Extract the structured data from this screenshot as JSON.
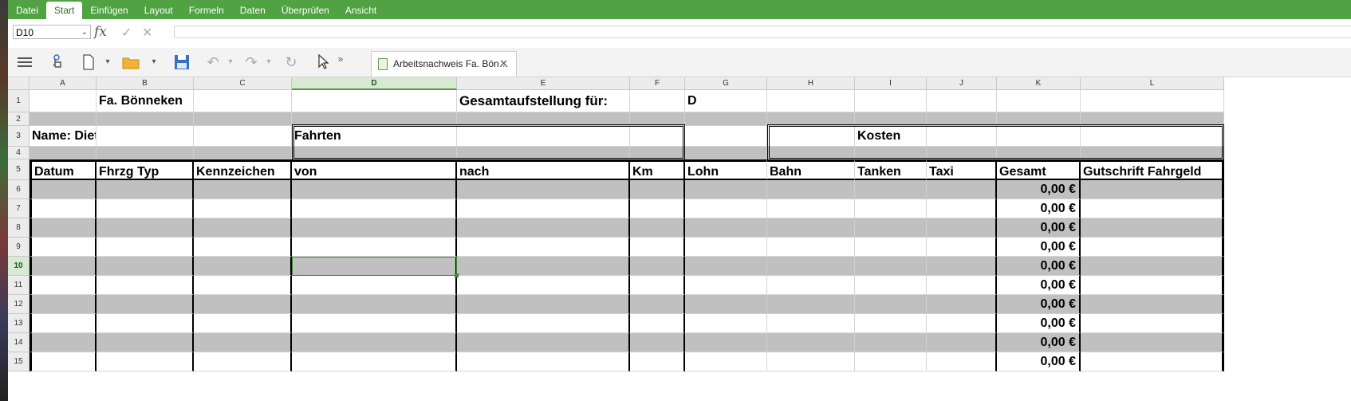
{
  "menu": {
    "items": [
      "Datei",
      "Start",
      "Einfügen",
      "Layout",
      "Formeln",
      "Daten",
      "Überprüfen",
      "Ansicht"
    ],
    "active": "Start"
  },
  "formula_bar": {
    "cell_ref": "D10",
    "fx_label": "fx",
    "accept_icon": "✓",
    "cancel_icon": "✕",
    "value": ""
  },
  "toolbar": {
    "document_tab_title": "Arbeitsnachweis Fa. Bön…",
    "tab_close": "✕",
    "overflow": "»"
  },
  "sheet": {
    "columns": [
      "A",
      "B",
      "C",
      "D",
      "E",
      "F",
      "G",
      "H",
      "I",
      "J",
      "K",
      "L"
    ],
    "selected_column": "D",
    "rows": [
      "1",
      "2",
      "3",
      "4",
      "5",
      "6",
      "7",
      "8",
      "9",
      "10",
      "11",
      "12",
      "13",
      "14",
      "15"
    ],
    "selected_row": "10",
    "row1": {
      "company": "Fa. Bönneken",
      "summary_label": "Gesamtaufstellung für:",
      "summary_value": "D"
    },
    "row3": {
      "name": "Name: Dieter Ritter",
      "trips_header": "Fahrten",
      "costs_header": "Kosten"
    },
    "headers": [
      "Datum",
      "Fhrzg Typ",
      "Kennzeichen",
      "von",
      "nach",
      "Km",
      "Lohn",
      "Bahn",
      "Tanken",
      "Taxi",
      "Gesamt",
      "Gutschrift Fahrgeld"
    ],
    "gesamt_values": [
      "0,00 €",
      "0,00 €",
      "0,00 €",
      "0,00 €",
      "0,00 €",
      "0,00 €",
      "0,00 €",
      "0,00 €",
      "0,00 €",
      "0,00 €"
    ]
  }
}
